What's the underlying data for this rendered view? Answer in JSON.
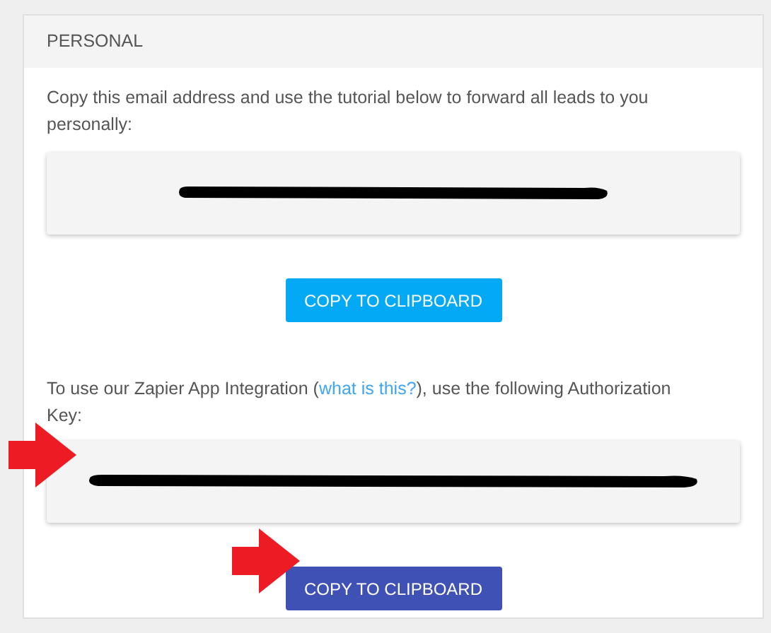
{
  "panel": {
    "title": "PERSONAL"
  },
  "sections": [
    {
      "text": "Copy this email address and use the tutorial below to forward all leads to you personally:",
      "field": {
        "redacted": true
      },
      "button": {
        "label": "COPY TO CLIPBOARD",
        "color": "#03a9f4"
      }
    },
    {
      "text_before": "To use our Zapier App Integration (",
      "link": "what is this?",
      "text_after": "), use the following Authorization Key:",
      "field": {
        "redacted": true
      },
      "button": {
        "label": "COPY TO CLIPBOARD",
        "color": "#3f51b5"
      },
      "annotated": true
    }
  ]
}
